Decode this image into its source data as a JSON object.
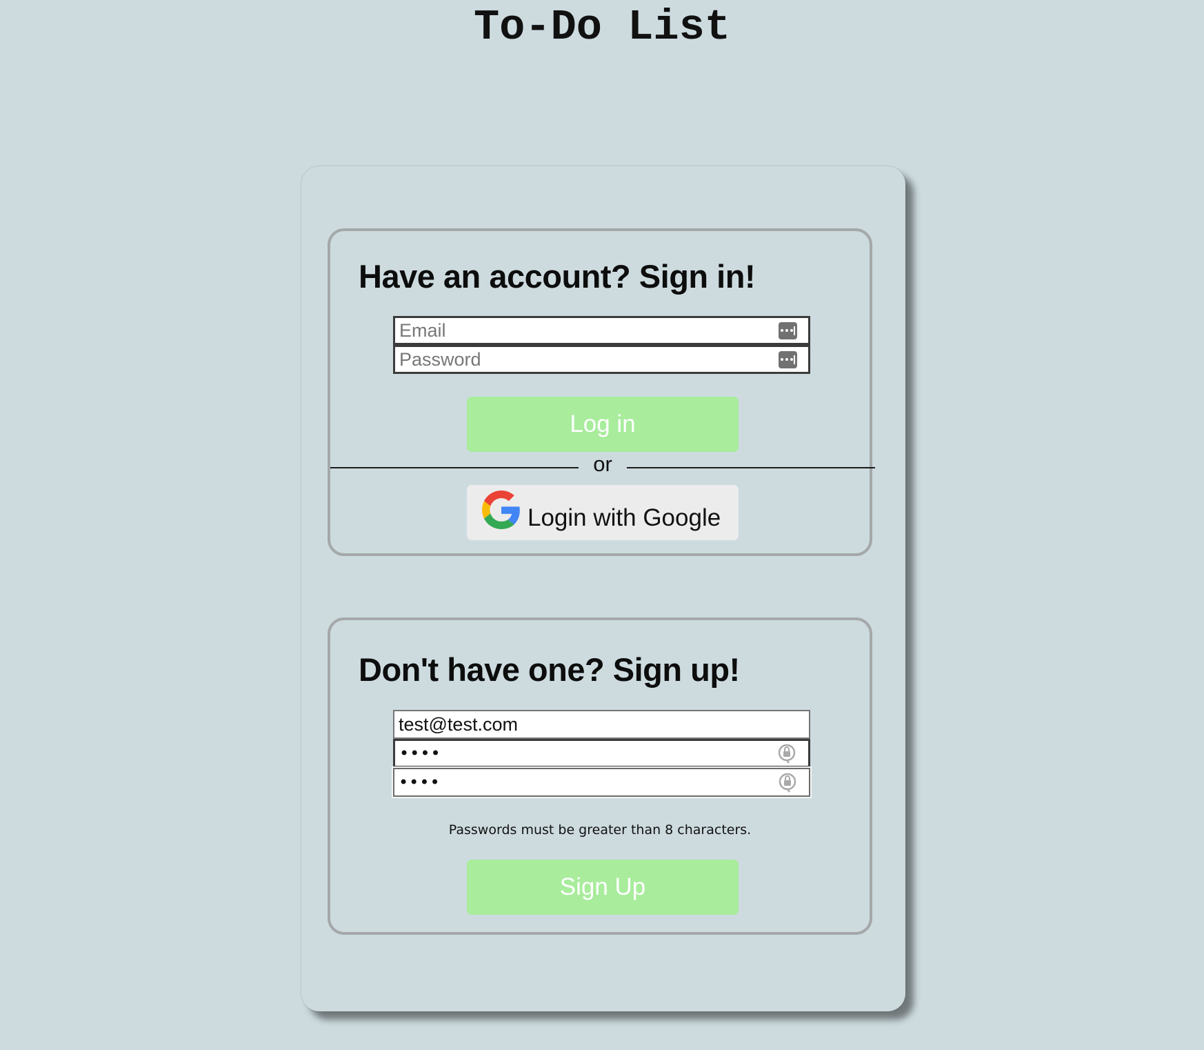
{
  "app": {
    "title": "To-Do List"
  },
  "signin": {
    "heading": "Have an account? Sign in!",
    "email_placeholder": "Email",
    "password_placeholder": "Password",
    "login_label": "Log in",
    "divider_text": "or",
    "google_label": "Login with Google"
  },
  "signup": {
    "heading": "Don't have one? Sign up!",
    "email_value": "test@test.com",
    "password_masked": "••••",
    "confirm_masked": "••••",
    "hint": "Passwords must be greater than 8 characters.",
    "signup_label": "Sign Up"
  },
  "colors": {
    "background": "#cddbdf",
    "button_green": "#a8ec9c",
    "google_button": "#ececec",
    "panel_border": "#a4a8a9"
  },
  "icons": {
    "field_autofill": "password-manager-key-icon",
    "field_lock": "password-lock-icon",
    "google": "google-logo-icon"
  }
}
